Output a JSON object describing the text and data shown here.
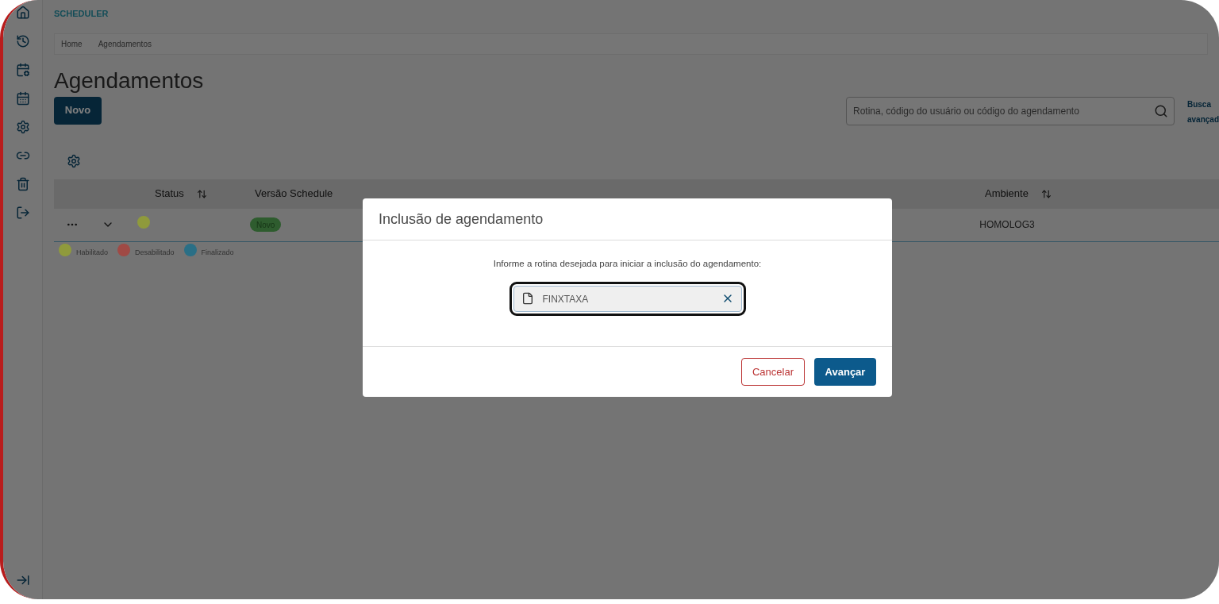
{
  "app_title": "SCHEDULER",
  "breadcrumb": [
    "Home",
    "Agendamentos"
  ],
  "page_title": "Agendamentos",
  "new_button": "Novo",
  "search": {
    "placeholder": "Rotina, código do usuário ou código do agendamento"
  },
  "advanced_search": [
    "Busca",
    "avançad"
  ],
  "table": {
    "columns": [
      {
        "label": "Status",
        "sortable": true
      },
      {
        "label": "Versão Schedule",
        "sortable": false
      },
      {
        "label": "Ambiente",
        "sortable": true
      }
    ],
    "rows": [
      {
        "color": "#8f9a3c",
        "version": "Novo",
        "environment": "HOMOLOG3"
      }
    ]
  },
  "legend": [
    {
      "label": "Habilitado",
      "color": "#8f9a3c"
    },
    {
      "label": "Desabilitado",
      "color": "#a04a45"
    },
    {
      "label": "Finalizado",
      "color": "#2a6f86"
    }
  ],
  "modal": {
    "title": "Inclusão de agendamento",
    "prompt": "Informe a rotina desejada para iniciar a inclusão do agendamento:",
    "value": "FINXTAXA",
    "buttons": [
      {
        "label": "Cancelar",
        "kind": "secondary"
      },
      {
        "label": "Avançar",
        "kind": "primary"
      }
    ]
  }
}
